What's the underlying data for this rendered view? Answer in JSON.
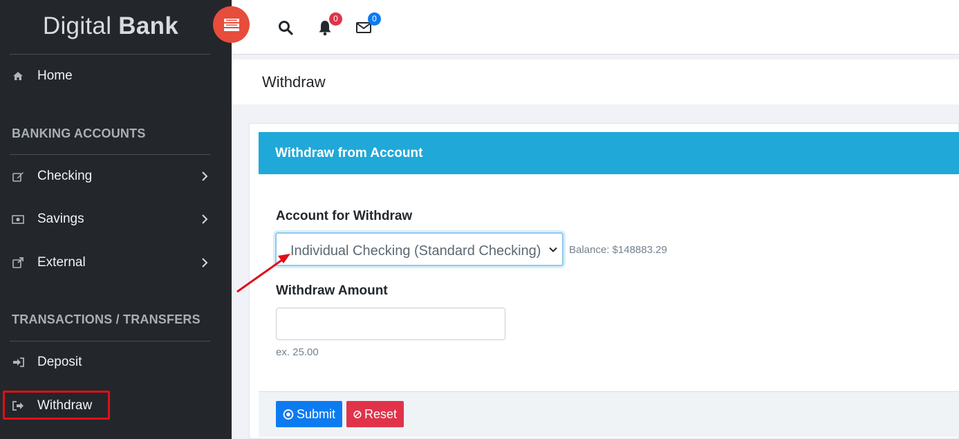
{
  "brand": {
    "light": "Digital",
    "bold": "Bank"
  },
  "header": {
    "notifications_count": "0",
    "messages_count": "0"
  },
  "sidebar": {
    "home": "Home",
    "banking_section": "BANKING ACCOUNTS",
    "checking": "Checking",
    "savings": "Savings",
    "external": "External",
    "transactions_section": "TRANSACTIONS / TRANSFERS",
    "deposit": "Deposit",
    "withdraw": "Withdraw"
  },
  "page": {
    "title": "Withdraw"
  },
  "card": {
    "header": "Withdraw from Account",
    "account_label": "Account for Withdraw",
    "account_selected": "Individual Checking (Standard Checking)",
    "balance": "Balance: $148883.29",
    "amount_label": "Withdraw Amount",
    "amount_value": "",
    "amount_hint": "ex. 25.00",
    "submit_label": "Submit",
    "reset_label": "Reset"
  },
  "colors": {
    "sidebar_bg": "#23272b",
    "accent_blue": "#20a8d8",
    "submit_blue": "#0d7bf0",
    "reset_red": "#e0334a",
    "toggle_red": "#e74c3c",
    "annotation_red": "#e00f18"
  },
  "icons": {
    "toggle": "menu-toggle-icon",
    "search": "search-icon",
    "notifications": "bell-icon",
    "messages": "envelope-icon",
    "home": "home-icon",
    "checking": "edit-icon",
    "savings": "money-icon",
    "external": "external-link-icon",
    "deposit": "sign-in-icon",
    "withdraw": "sign-out-icon"
  }
}
